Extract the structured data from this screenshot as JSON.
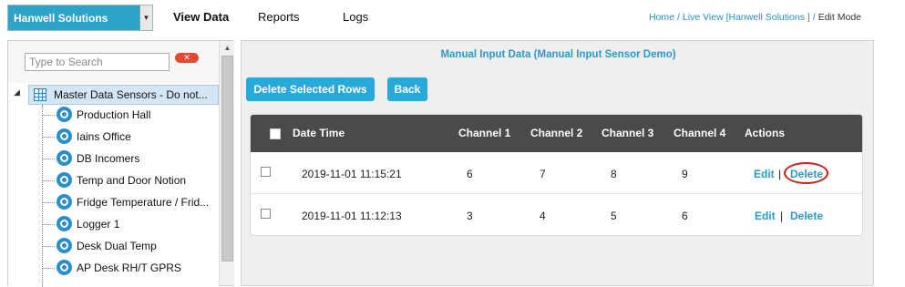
{
  "header": {
    "org_select": "Hanwell Solutions",
    "nav": [
      "View Data",
      "Reports",
      "Logs"
    ],
    "breadcrumb": [
      "Home",
      "Live View [Hanwell Solutions ]",
      "Edit Mode"
    ]
  },
  "sidebar": {
    "search_placeholder": "Type to Search",
    "tree_root": "Master Data Sensors - Do not...",
    "items": [
      "Production Hall",
      "Iains Office",
      "DB Incomers",
      "Temp and Door Notion",
      "Fridge Temperature / Frid...",
      "Logger 1",
      "Desk Dual Temp",
      "AP Desk RH/T GPRS"
    ]
  },
  "main": {
    "title": "Manual Input Data (Manual Input Sensor Demo)",
    "buttons": {
      "delete_rows": "Delete Selected Rows",
      "back": "Back"
    },
    "table": {
      "columns": [
        "Date Time",
        "Channel 1",
        "Channel 2",
        "Channel 3",
        "Channel 4",
        "Actions"
      ],
      "rows": [
        {
          "datetime": "2019-11-01 11:15:21",
          "ch1": "6",
          "ch2": "7",
          "ch3": "8",
          "ch4": "9",
          "edit": "Edit",
          "sep": "|",
          "delete": "Delete"
        },
        {
          "datetime": "2019-11-01 11:12:13",
          "ch1": "3",
          "ch2": "4",
          "ch3": "5",
          "ch4": "6",
          "edit": "Edit",
          "sep": "|",
          "delete": "Delete"
        }
      ]
    }
  },
  "colors": {
    "accent": "#27a9dc",
    "header_bg": "#4a4a4a",
    "highlight": "#cc1f1f"
  }
}
